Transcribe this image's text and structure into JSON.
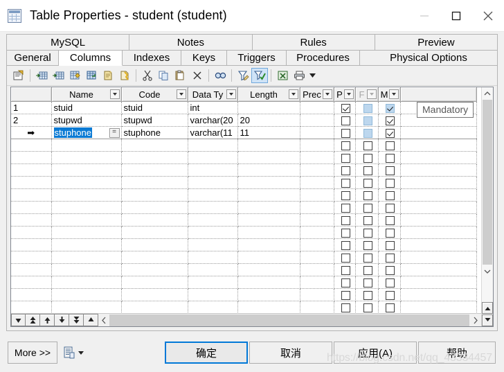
{
  "window": {
    "title": "Table Properties - student (student)",
    "icon": "table-icon",
    "minimize_label": "Minimize",
    "maximize_label": "Maximize",
    "close_label": "Close"
  },
  "tabs": {
    "row1": [
      {
        "label": "MySQL",
        "active": false
      },
      {
        "label": "Notes",
        "active": false
      },
      {
        "label": "Rules",
        "active": false
      },
      {
        "label": "Preview",
        "active": false
      }
    ],
    "row2": [
      {
        "label": "General",
        "active": false
      },
      {
        "label": "Columns",
        "active": true
      },
      {
        "label": "Indexes",
        "active": false
      },
      {
        "label": "Keys",
        "active": false
      },
      {
        "label": "Triggers",
        "active": false
      },
      {
        "label": "Procedures",
        "active": false
      },
      {
        "label": "Physical Options",
        "active": false
      }
    ]
  },
  "toolbar": {
    "items": [
      {
        "name": "properties-icon",
        "tip": "Properties"
      },
      {
        "name": "insert-row-icon",
        "tip": "Insert a Row"
      },
      {
        "name": "add-row-icon",
        "tip": "Add a Row"
      },
      {
        "name": "add-column-icon",
        "tip": "Add a Column"
      },
      {
        "name": "duplicate-row-icon",
        "tip": "Duplicate Row"
      },
      {
        "name": "new-object-icon",
        "tip": "New Object"
      },
      {
        "name": "delete-object-icon",
        "tip": "Delete Object"
      },
      {
        "name": "cut-icon",
        "tip": "Cut"
      },
      {
        "name": "copy-icon",
        "tip": "Copy"
      },
      {
        "name": "paste-icon",
        "tip": "Paste"
      },
      {
        "name": "delete-icon",
        "tip": "Delete"
      },
      {
        "name": "find-icon",
        "tip": "Find"
      },
      {
        "name": "customize-filter-icon",
        "tip": "Customize Filter"
      },
      {
        "name": "apply-filter-icon",
        "tip": "Apply Filter",
        "pressed": true
      },
      {
        "name": "export-excel-icon",
        "tip": "Export to Excel"
      },
      {
        "name": "print-icon",
        "tip": "Print"
      },
      {
        "name": "toolbar-dropdown-icon",
        "tip": "More"
      }
    ]
  },
  "grid": {
    "columns": [
      {
        "key": "rownum",
        "label": "",
        "filter": false
      },
      {
        "key": "name",
        "label": "Name",
        "filter": true
      },
      {
        "key": "code",
        "label": "Code",
        "filter": true
      },
      {
        "key": "datatype",
        "label": "Data Ty",
        "filter": true
      },
      {
        "key": "length",
        "label": "Length",
        "filter": true
      },
      {
        "key": "precision",
        "label": "Prec",
        "filter": true
      },
      {
        "key": "p",
        "label": "P",
        "filter": true
      },
      {
        "key": "f",
        "label": "F",
        "filter": true,
        "disabled": true
      },
      {
        "key": "m",
        "label": "M",
        "filter": true
      }
    ],
    "rows": [
      {
        "rownum": "1",
        "current": false,
        "editing": false,
        "name": "stuid",
        "code": "stuid",
        "datatype": "int",
        "length": "",
        "precision": "",
        "p": {
          "checked": true,
          "style": "normal"
        },
        "f": {
          "checked": false,
          "style": "blue"
        },
        "m": {
          "checked": true,
          "style": "blue"
        }
      },
      {
        "rownum": "2",
        "current": false,
        "editing": false,
        "name": "stupwd",
        "code": "stupwd",
        "datatype": "varchar(20",
        "length": "20",
        "precision": "",
        "p": {
          "checked": false,
          "style": "normal"
        },
        "f": {
          "checked": false,
          "style": "blue"
        },
        "m": {
          "checked": true,
          "style": "normal"
        }
      },
      {
        "rownum": "",
        "current": true,
        "editing": true,
        "name": "stuphone",
        "name_selected": true,
        "has_ellipsis": true,
        "ellipsis_label": "=",
        "code": "stuphone",
        "datatype": "varchar(11",
        "length": "11",
        "precision": "",
        "p": {
          "checked": false,
          "style": "normal"
        },
        "f": {
          "checked": false,
          "style": "blue"
        },
        "m": {
          "checked": true,
          "style": "normal"
        }
      }
    ],
    "empty_row_count": 14,
    "tooltip": "Mandatory",
    "current_row_marker": "➡"
  },
  "navigation": {
    "first_label": "First",
    "prev_page_label": "Previous Page",
    "prev_label": "Previous",
    "next_label": "Next",
    "next_page_label": "Next Page",
    "last_label": "Last"
  },
  "footer": {
    "more_label": "More >>",
    "report_icon": "report-icon",
    "report_dropdown_icon": "dropdown-caret-icon",
    "buttons": [
      {
        "key": "ok",
        "label": "确定",
        "default": true
      },
      {
        "key": "cancel",
        "label": "取消",
        "default": false
      },
      {
        "key": "apply",
        "label": "应用(A)",
        "accel": "A",
        "default": false
      },
      {
        "key": "help",
        "label": "帮助",
        "default": false
      }
    ]
  },
  "watermark": "https://blog.csdn.net/qq_43334457"
}
